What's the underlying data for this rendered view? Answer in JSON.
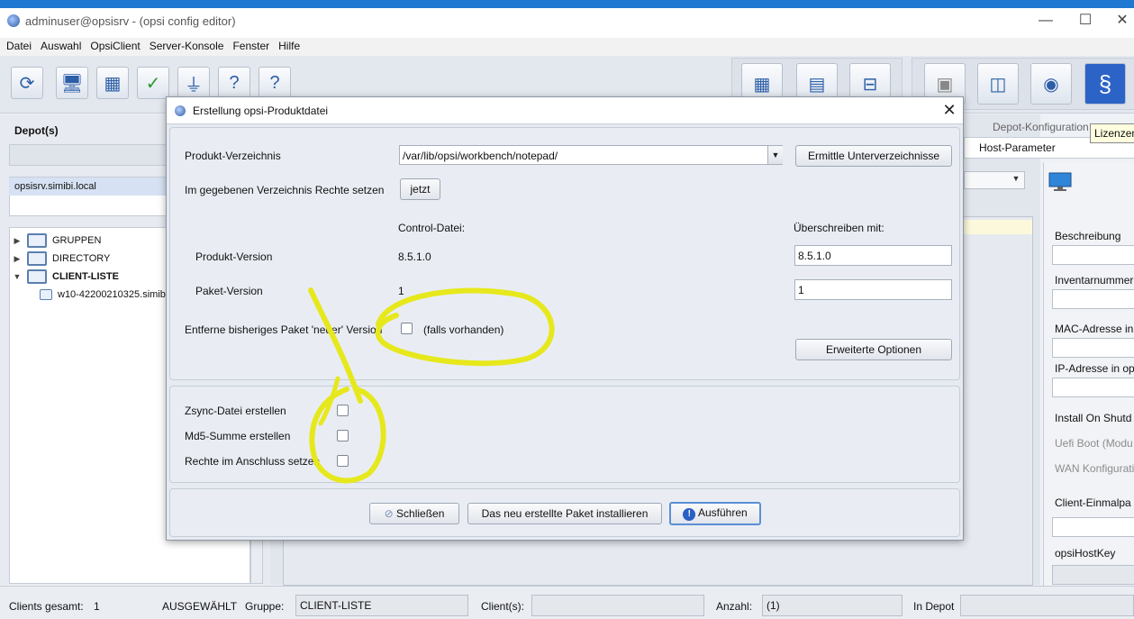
{
  "window": {
    "title": "adminuser@opsisrv - (opsi config editor)"
  },
  "menu": [
    "Datei",
    "Auswahl",
    "OpsiClient",
    "Server-Konsole",
    "Fenster",
    "Hilfe"
  ],
  "left": {
    "depot_title": "Depot(s)",
    "depot_item": "opsisrv.simibi.local",
    "tree": [
      {
        "label": "GRUPPEN",
        "expanded": false
      },
      {
        "label": "DIRECTORY",
        "expanded": false
      },
      {
        "label": "CLIENT-LISTE",
        "expanded": true
      },
      {
        "label": "w10-42200210325.simibi",
        "child": true
      }
    ]
  },
  "tabs": {
    "depot_config": "Depot-Konfiguration",
    "host_params": "Host-Parameter",
    "tooltip": "Lizenzen"
  },
  "right": {
    "labels": [
      "Beschreibung",
      "Inventarnummer",
      "MAC-Adresse in",
      "IP-Adresse in op",
      "Install On Shutd",
      "Uefi Boot (Modu",
      "WAN Konfigurati",
      "Client-Einmalpa",
      "opsiHostKey"
    ]
  },
  "dialog": {
    "title": "Erstellung opsi-Produktdatei",
    "product_dir_label": "Produkt-Verzeichnis",
    "product_dir_value": "/var/lib/opsi/workbench/notepad/",
    "find_subdirs_button": "Ermittle Unterverzeichnisse",
    "set_rights_label": "Im gegebenen Verzeichnis Rechte setzen",
    "now_button": "jetzt",
    "control_file_header": "Control-Datei:",
    "overwrite_header": "Überschreiben mit:",
    "product_version_label": "Produkt-Version",
    "product_version_control": "8.5.1.0",
    "product_version_override": "8.5.1.0",
    "package_version_label": "Paket-Version",
    "package_version_control": "1",
    "package_version_override": "1",
    "remove_label": "Entferne bisheriges Paket 'neuer' Version",
    "if_exists_label": "(falls vorhanden)",
    "advanced_button": "Erweiterte Optionen",
    "zsync_label": "Zsync-Datei erstellen",
    "md5_label": "Md5-Summe erstellen",
    "rights_after_label": "Rechte im Anschluss setzen",
    "close_button": "Schließen",
    "install_button": "Das neu erstellte Paket installieren",
    "run_button": "Ausführen"
  },
  "status": {
    "clients_total_label": "Clients gesamt:",
    "clients_total_value": "1",
    "selected_label": "AUSGEWÄHLT",
    "group_label": "Gruppe:",
    "group_value": "CLIENT-LISTE",
    "clients_label": "Client(s):",
    "clients_value": "",
    "count_label": "Anzahl:",
    "count_value": "(1)",
    "in_depot_label": "In Depot",
    "in_depot_value": ""
  },
  "colors": {
    "accent": "#1f78d1",
    "annotation": "#e6e81c"
  }
}
